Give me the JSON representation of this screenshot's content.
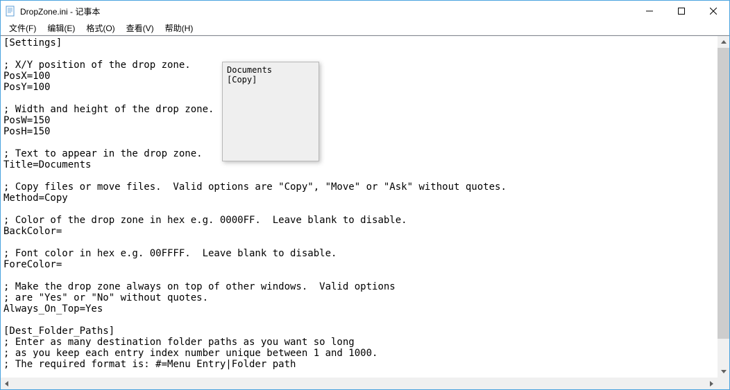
{
  "window": {
    "title": "DropZone.ini - 记事本"
  },
  "menu": {
    "file": "文件(F)",
    "edit": "编辑(E)",
    "format": "格式(O)",
    "view": "查看(V)",
    "help": "帮助(H)"
  },
  "editor": {
    "content": "[Settings]\n\n; X/Y position of the drop zone.\nPosX=100\nPosY=100\n\n; Width and height of the drop zone.\nPosW=150\nPosH=150\n\n; Text to appear in the drop zone.\nTitle=Documents\n\n; Copy files or move files.  Valid options are \"Copy\", \"Move\" or \"Ask\" without quotes.\nMethod=Copy\n\n; Color of the drop zone in hex e.g. 0000FF.  Leave blank to disable.\nBackColor=\n\n; Font color in hex e.g. 00FFFF.  Leave blank to disable.\nForeColor=\n\n; Make the drop zone always on top of other windows.  Valid options\n; are \"Yes\" or \"No\" without quotes.\nAlways_On_Top=Yes\n\n[Dest_Folder_Paths]\n; Enter as many destination folder paths as you want so long\n; as you keep each entry index number unique between 1 and 1000.\n; The required format is: #=Menu Entry|Folder path"
  },
  "dropzone": {
    "title": "Documents",
    "method": "[Copy]"
  }
}
